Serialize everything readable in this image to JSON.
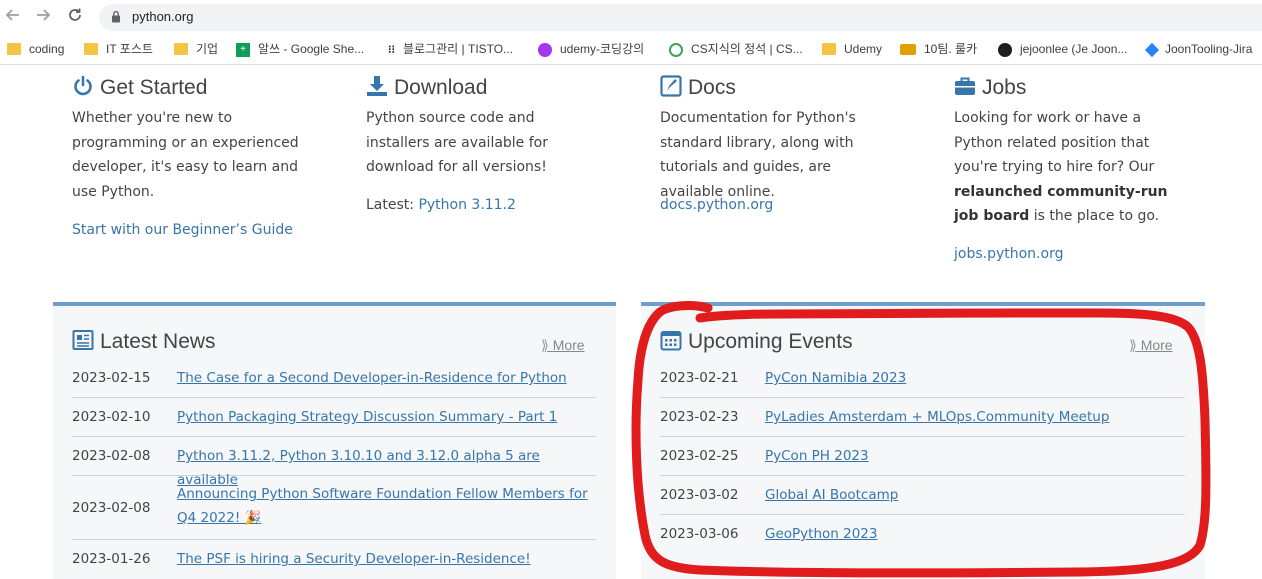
{
  "browser": {
    "url": "python.org",
    "bookmarks": [
      {
        "label": "coding",
        "icon": "folder-icon"
      },
      {
        "label": "IT 포스트",
        "icon": "folder-icon"
      },
      {
        "label": "기업",
        "icon": "folder-icon"
      },
      {
        "label": "알쓰 - Google She...",
        "icon": "google-sheets-icon"
      },
      {
        "label": "블로그관리 | TISTO...",
        "icon": "tistory-icon"
      },
      {
        "label": "udemy-코딩강의",
        "icon": "udemy-icon"
      },
      {
        "label": "CS지식의 정석 | CS...",
        "icon": "clock-icon"
      },
      {
        "label": "Udemy",
        "icon": "folder-icon"
      },
      {
        "label": "10팀. 룰카",
        "icon": "card-icon"
      },
      {
        "label": "jejoonlee (Je Joon...",
        "icon": "github-icon"
      },
      {
        "label": "JoonTooling-Jira",
        "icon": "jira-icon"
      }
    ]
  },
  "intro": [
    {
      "title": "Get Started",
      "icon": "power-icon",
      "text": "Whether you're new to programming or an experienced developer, it's easy to learn and use Python.",
      "link": "Start with our Beginner’s Guide"
    },
    {
      "title": "Download",
      "icon": "download-icon",
      "text": "Python source code and installers are available for download for all versions!",
      "latest_label": "Latest: ",
      "link": "Python 3.11.2"
    },
    {
      "title": "Docs",
      "icon": "docs-icon",
      "text": "Documentation for Python's standard library, along with tutorials and guides, are available online.",
      "link": "docs.python.org"
    },
    {
      "title": "Jobs",
      "icon": "briefcase-icon",
      "text_a": "Looking for work or have a Python related position that you're trying to hire for? Our ",
      "text_bold": "relaunched community-run job board",
      "text_b": " is the place to go.",
      "link": "jobs.python.org"
    }
  ],
  "news": {
    "title": "Latest News",
    "icon": "newspaper-icon",
    "more": "More",
    "items": [
      {
        "date": "2023-02-15",
        "title": "The Case for a Second Developer-in-Residence for Python"
      },
      {
        "date": "2023-02-10",
        "title": "Python Packaging Strategy Discussion Summary - Part 1"
      },
      {
        "date": "2023-02-08",
        "title": "Python 3.11.2, Python 3.10.10 and 3.12.0 alpha 5 are available"
      },
      {
        "date": "2023-02-08",
        "title": "Announcing Python Software Foundation Fellow Members for Q4 2022! 🎉"
      },
      {
        "date": "2023-01-26",
        "title": "The PSF is hiring a Security Developer-in-Residence!"
      }
    ]
  },
  "events": {
    "title": "Upcoming Events",
    "icon": "calendar-icon",
    "more": "More",
    "items": [
      {
        "date": "2023-02-21",
        "title": "PyCon Namibia 2023"
      },
      {
        "date": "2023-02-23",
        "title": "PyLadies Amsterdam + MLOps.Community Meetup"
      },
      {
        "date": "2023-02-25",
        "title": "PyCon PH 2023"
      },
      {
        "date": "2023-03-02",
        "title": "Global AI Bootcamp"
      },
      {
        "date": "2023-03-06",
        "title": "GeoPython 2023"
      }
    ]
  },
  "colors": {
    "link": "#3776ab",
    "panel_bar": "#6fa0cc",
    "annotation": "#e01c1c"
  }
}
